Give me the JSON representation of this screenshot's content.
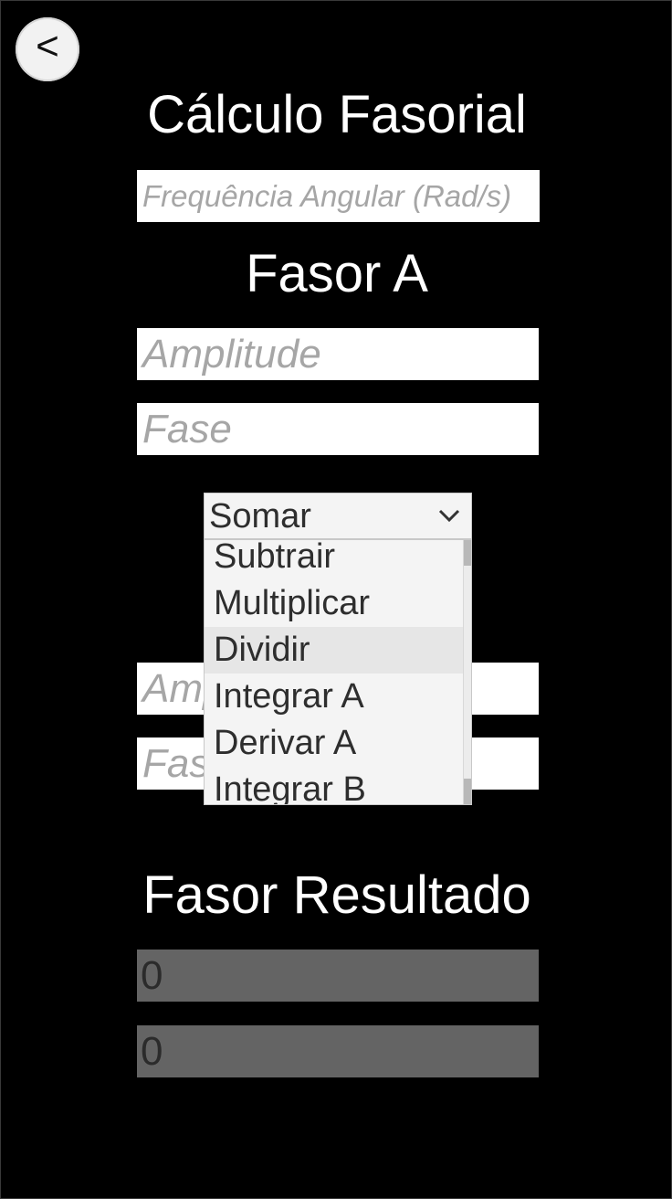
{
  "back_button": {
    "label": "<"
  },
  "title": "Cálculo Fasorial",
  "frequency": {
    "placeholder": "Frequência Angular (Rad/s)"
  },
  "fasor_a": {
    "heading": "Fasor A",
    "amplitude_placeholder": "Amplitude",
    "fase_placeholder": "Fase"
  },
  "operation": {
    "selected": "Somar",
    "options": [
      "Subtrair",
      "Multiplicar",
      "Dividir",
      "Integrar A",
      "Derivar A",
      "Integrar B"
    ],
    "highlighted": "Dividir"
  },
  "fasor_b": {
    "amplitude_placeholder": "Amplitude",
    "fase_placeholder": "Fase"
  },
  "resultado": {
    "heading": "Fasor Resultado",
    "amplitude_value": "0",
    "fase_value": "0"
  },
  "icons": {
    "back": "back-arrow-icon",
    "dropdown": "chevron-down-icon"
  }
}
